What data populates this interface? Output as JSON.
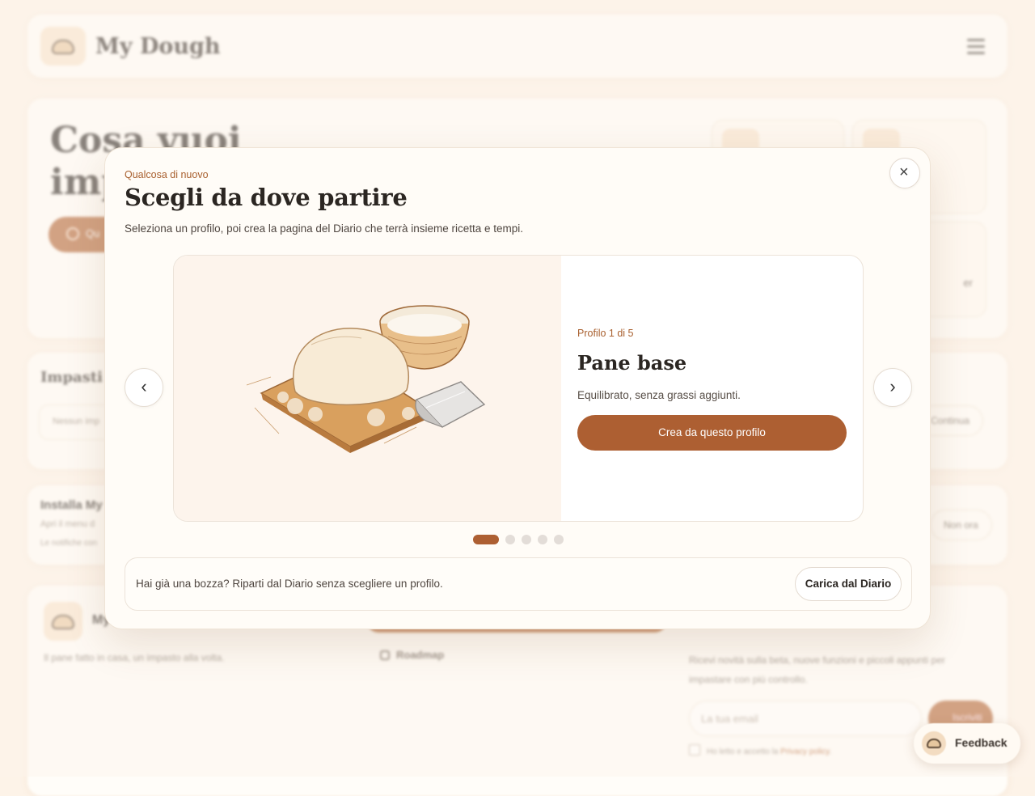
{
  "app": {
    "brand": "My Dough"
  },
  "hero": {
    "title_line1": "Cosa vuoi",
    "title_line2": "imp",
    "button_label": "Qu",
    "mini_card_text": "er"
  },
  "impasti": {
    "title": "Impasti p",
    "empty_text": "Nessun imp",
    "continue_label": "Continua"
  },
  "install": {
    "title": "Installa My",
    "line1": "Apri il menu d",
    "line2": "Le notifiche con",
    "dismiss_label": "Non ora"
  },
  "footer": {
    "brand_short": "My",
    "tagline": "Il pane fatto in casa, un impasto alla volta.",
    "roadmap_label": "Roadmap",
    "newsletter_text": "Ricevi novità sulla beta, nuove funzioni e piccoli appunti per impastare con più controllo.",
    "email_placeholder": "La tua email",
    "subscribe_label": "Iscriviti",
    "consent_prefix": "Ho letto e accetto la ",
    "consent_link": "Privacy policy",
    "consent_suffix": "."
  },
  "feedback": {
    "label": "Feedback"
  },
  "modal": {
    "eyebrow": "Qualcosa di nuovo",
    "title": "Scegli da dove partire",
    "description": "Seleziona un profilo, poi crea la pagina del Diario che terrà insieme ricetta e tempi.",
    "close_icon": "×",
    "prev_icon": "‹",
    "next_icon": "›",
    "slide": {
      "counter": "Profilo 1 di 5",
      "name": "Pane base",
      "description": "Equilibrato, senza grassi aggiunti.",
      "cta_label": "Crea da questo profilo"
    },
    "pagination": {
      "total": 5,
      "active_index": 0
    },
    "draft": {
      "text": "Hai già una bozza? Riparti dal Diario senza scegliere un profilo.",
      "button_label": "Carica dal Diario"
    }
  },
  "colors": {
    "accent": "#ad5f32",
    "accent_text": "#a9602f",
    "background": "#fdf3e8",
    "card": "#fffcf7"
  }
}
